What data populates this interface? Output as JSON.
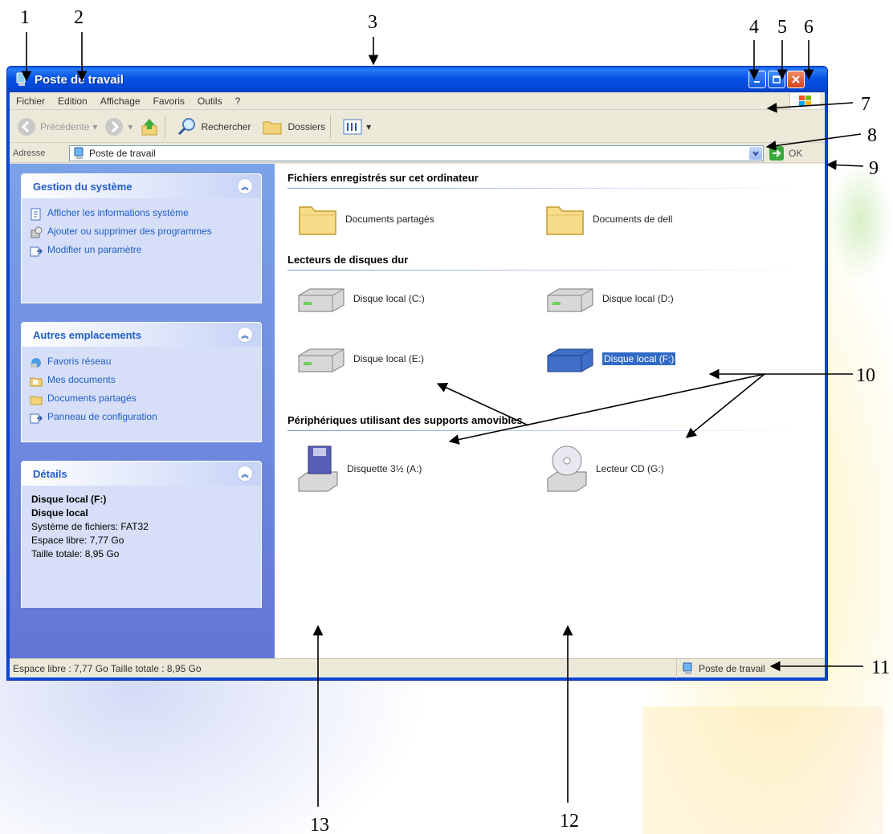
{
  "annotations": [
    "1",
    "2",
    "3",
    "4",
    "5",
    "6",
    "7",
    "8",
    "9",
    "10",
    "11",
    "12",
    "13"
  ],
  "window": {
    "title": "Poste de travail"
  },
  "menu": [
    "Fichier",
    "Edition",
    "Affichage",
    "Favoris",
    "Outils",
    "?"
  ],
  "toolbar": {
    "back": "Précédente",
    "search": "Rechercher",
    "folders": "Dossiers"
  },
  "address": {
    "label": "Adresse",
    "value": "Poste de travail",
    "go": "OK"
  },
  "left_pane": {
    "system": {
      "title": "Gestion du système",
      "tasks": [
        "Afficher les informations système",
        "Ajouter ou supprimer des programmes",
        "Modifier un paramètre"
      ]
    },
    "places": {
      "title": "Autres emplacements",
      "items": [
        "Favoris réseau",
        "Mes documents",
        "Documents partagés",
        "Panneau de configuration"
      ]
    },
    "details": {
      "title": "Détails",
      "name": "Disque local (F:)",
      "type": "Disque local",
      "filesystem": "Système de fichiers: FAT32",
      "free": "Espace libre: 7,77 Go",
      "total": "Taille totale: 8,95 Go"
    }
  },
  "content": {
    "group_files": "Fichiers enregistrés sur cet ordinateur",
    "shared_docs": "Documents partagés",
    "user_docs": "Documents de dell",
    "group_drives": "Lecteurs de disques dur",
    "drive_c": "Disque local (C:)",
    "drive_d": "Disque local (D:)",
    "drive_e": "Disque local (E:)",
    "drive_f": "Disque local (F:)",
    "group_removable": "Périphériques utilisant des supports amovibles",
    "floppy": "Disquette 3½ (A:)",
    "cd": "Lecteur CD (G:)"
  },
  "status": {
    "left": "Espace libre : 7,77 Go Taille totale : 8,95 Go",
    "right": "Poste de travail"
  },
  "colors": {
    "titlebar": "#0553e5",
    "pane": "#6f8ddd",
    "link": "#215dc6",
    "selection": "#316ac5"
  }
}
